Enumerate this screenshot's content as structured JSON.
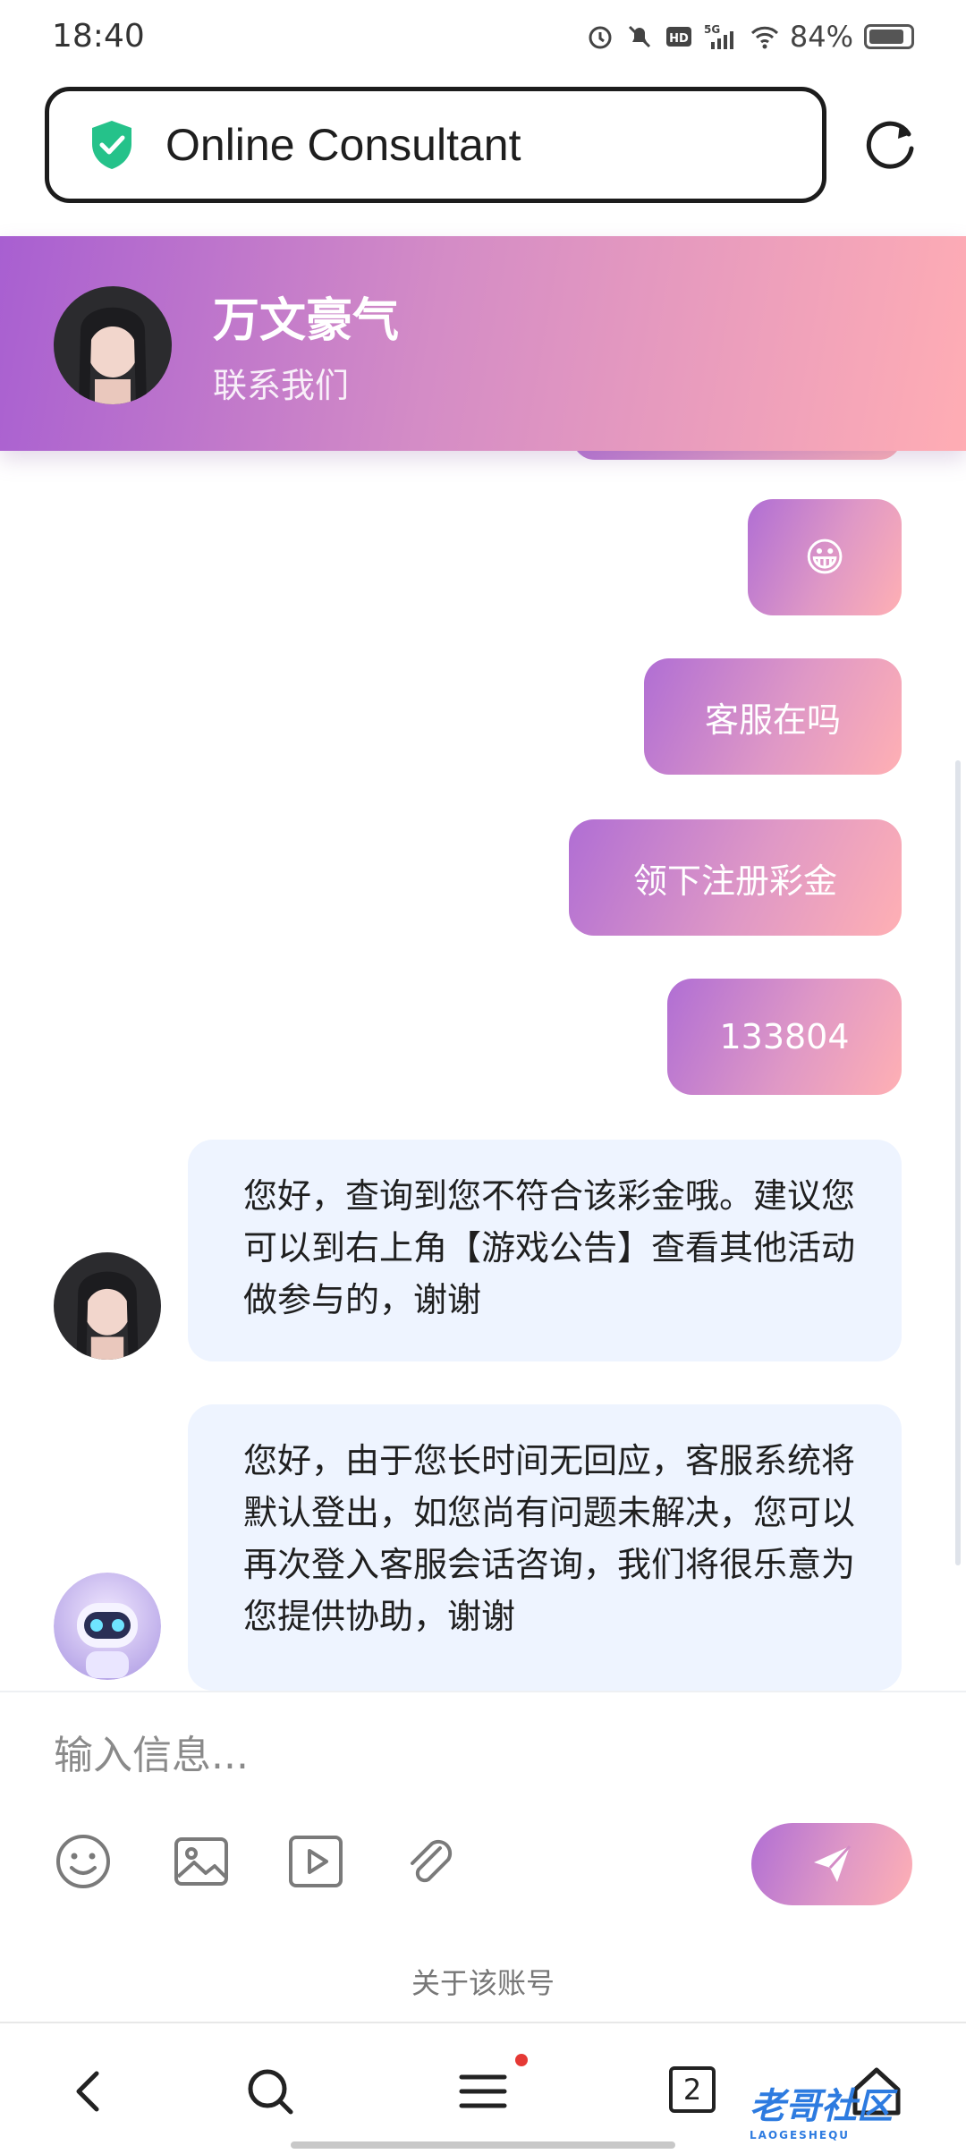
{
  "status_bar": {
    "time": "18:40",
    "network": "5G",
    "battery_text": "84%",
    "icons": [
      "alarm-icon",
      "mute-icon",
      "hd-icon",
      "signal-icon",
      "wifi-icon",
      "battery-icon"
    ]
  },
  "browser": {
    "page_title": "Online Consultant",
    "security_icon": "shield-check-icon",
    "reload_icon": "reload-icon"
  },
  "header": {
    "name": "万文豪气",
    "subtitle": "联系我们"
  },
  "messages": [
    {
      "from": "user",
      "text": "😀"
    },
    {
      "from": "user",
      "text": "客服在吗"
    },
    {
      "from": "user",
      "text": "领下注册彩金"
    },
    {
      "from": "user",
      "text": "133804"
    },
    {
      "from": "agent",
      "text": "您好，查询到您不符合该彩金哦。建议您可以到右上角【游戏公告】查看其他活动做参与的，谢谢"
    },
    {
      "from": "bot",
      "text": "您好，由于您长时间无回应，客服系统将默认登出，如您尚有问题未解决，您可以再次登入客服会话咨询，我们将很乐意为您提供协助，谢谢"
    }
  ],
  "composer": {
    "placeholder": "输入信息...",
    "tools": [
      "emoji-icon",
      "image-icon",
      "video-icon",
      "attachment-icon"
    ],
    "send_icon": "send-icon",
    "about_link": "关于该账号"
  },
  "bottom_nav": {
    "tab_count": "2",
    "watermark": "老哥社区",
    "watermark_sub": "LAOGESHEQU"
  },
  "colors": {
    "accent_start": "#a85fd1",
    "accent_end": "#ffadb4",
    "incoming_bubble": "#eef4ff",
    "shield_green": "#25c28a"
  }
}
